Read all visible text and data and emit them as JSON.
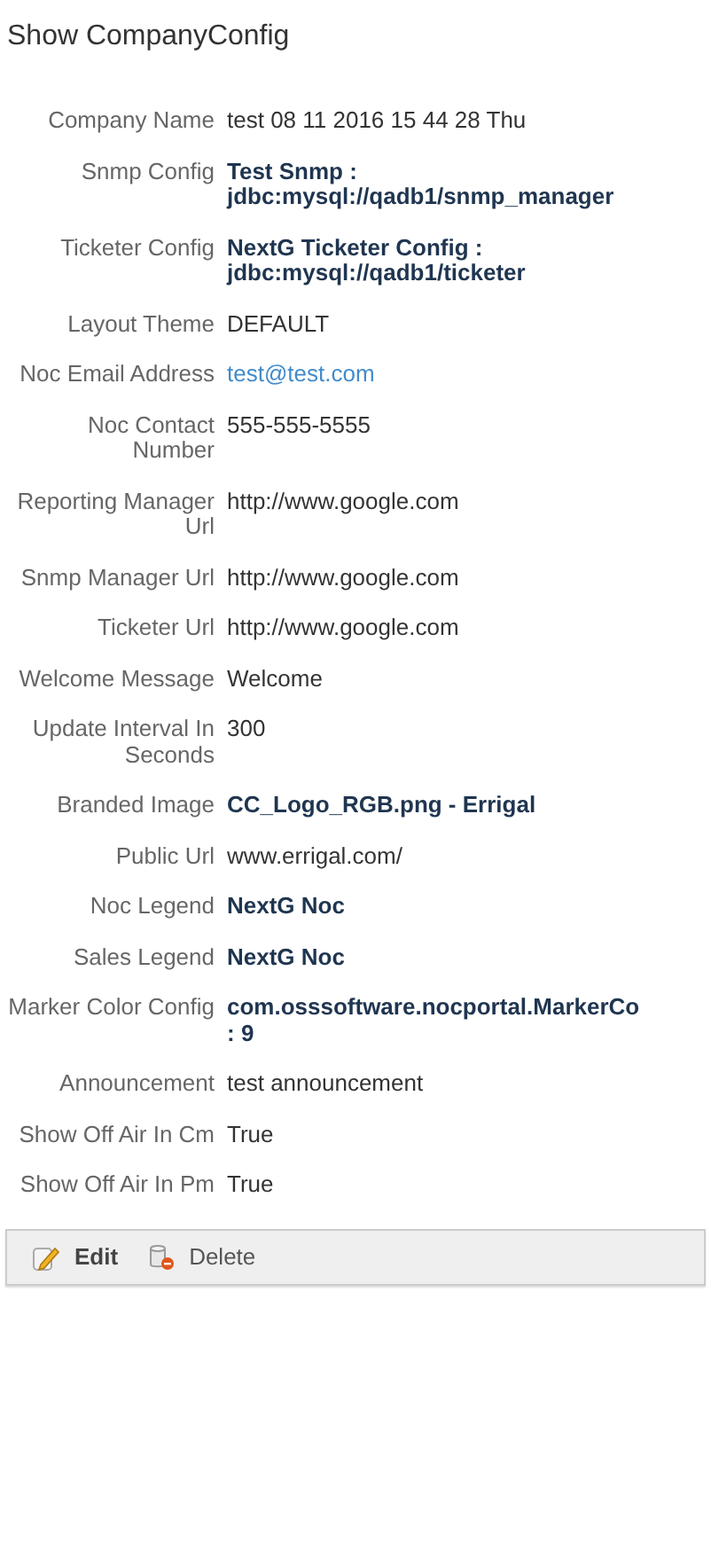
{
  "title": "Show CompanyConfig",
  "fields": [
    {
      "label": "Company Name",
      "value": "test 08 11 2016 15 44 28 Thu",
      "kind": "text"
    },
    {
      "label": "Snmp Config",
      "value": "Test Snmp : jdbc:mysql://qadb1/snmp_manager",
      "kind": "reference"
    },
    {
      "label": "Ticketer Config",
      "value": "NextG Ticketer Config : jdbc:mysql://qadb1/ticketer",
      "kind": "reference"
    },
    {
      "label": "Layout Theme",
      "value": "DEFAULT",
      "kind": "text"
    },
    {
      "label": "Noc Email Address",
      "value": "test@test.com",
      "kind": "link"
    },
    {
      "label": "Noc Contact Number",
      "value": "555-555-5555",
      "kind": "text"
    },
    {
      "label": "Reporting Manager Url",
      "value": "http://www.google.com",
      "kind": "text"
    },
    {
      "label": "Snmp Manager Url",
      "value": "http://www.google.com",
      "kind": "text"
    },
    {
      "label": "Ticketer Url",
      "value": "http://www.google.com",
      "kind": "text"
    },
    {
      "label": "Welcome Message",
      "value": "Welcome",
      "kind": "text"
    },
    {
      "label": "Update Interval In Seconds",
      "value": "300",
      "kind": "text"
    },
    {
      "label": "Branded Image",
      "value": "CC_Logo_RGB.png - Errigal",
      "kind": "reference"
    },
    {
      "label": "Public Url",
      "value": "www.errigal.com/",
      "kind": "text"
    },
    {
      "label": "Noc Legend",
      "value": "NextG Noc",
      "kind": "reference"
    },
    {
      "label": "Sales Legend",
      "value": "NextG Noc",
      "kind": "reference"
    },
    {
      "label": "Marker Color Config",
      "value": "com.osssoftware.nocportal.MarkerCo : 9",
      "kind": "reference"
    },
    {
      "label": "Announcement",
      "value": "test announcement",
      "kind": "text"
    },
    {
      "label": "Show Off Air In Cm",
      "value": "True",
      "kind": "text"
    },
    {
      "label": "Show Off Air In Pm",
      "value": "True",
      "kind": "text"
    }
  ],
  "buttons": [
    {
      "label": "Edit",
      "kind": "edit"
    },
    {
      "label": "Delete",
      "kind": "delete"
    }
  ]
}
